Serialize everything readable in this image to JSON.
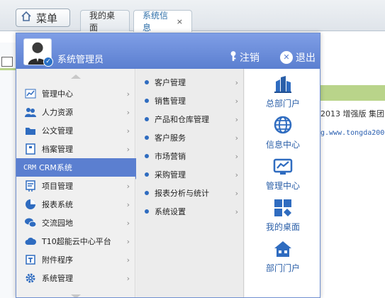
{
  "top": {
    "menu_label": "菜单",
    "tabs": [
      {
        "label": "我的桌面",
        "active": false
      },
      {
        "label": "系统信息",
        "active": true,
        "close": "×"
      }
    ]
  },
  "background": {
    "text1": "2013 增强版 集团",
    "text2": "g.www.tongda2000"
  },
  "popup": {
    "user_name": "系统管理员",
    "logout_label": "注销",
    "exit_label": "退出",
    "primary_menu": [
      {
        "label": "管理中心",
        "icon": "chart-icon"
      },
      {
        "label": "人力资源",
        "icon": "people-icon"
      },
      {
        "label": "公文管理",
        "icon": "folder-icon"
      },
      {
        "label": "档案管理",
        "icon": "archive-icon"
      },
      {
        "label": "CRM系统",
        "tag": "CRM",
        "icon": "crm-icon",
        "active": true
      },
      {
        "label": "项目管理",
        "icon": "project-icon"
      },
      {
        "label": "报表系统",
        "icon": "pie-icon"
      },
      {
        "label": "交流园地",
        "icon": "chat-icon"
      },
      {
        "label": "T10超能云中心平台",
        "icon": "cloud-icon"
      },
      {
        "label": "附件程序",
        "icon": "attachment-icon"
      },
      {
        "label": "系统管理",
        "icon": "gear-icon"
      }
    ],
    "submenu": [
      {
        "label": "客户管理"
      },
      {
        "label": "销售管理"
      },
      {
        "label": "产品和仓库管理"
      },
      {
        "label": "客户服务"
      },
      {
        "label": "市场营销"
      },
      {
        "label": "采购管理"
      },
      {
        "label": "报表分析与统计"
      },
      {
        "label": "系统设置"
      }
    ],
    "shortcuts": [
      {
        "label": "总部门户",
        "icon": "building-icon"
      },
      {
        "label": "信息中心",
        "icon": "globe-icon"
      },
      {
        "label": "管理中心",
        "icon": "monitor-chart-icon"
      },
      {
        "label": "我的桌面",
        "icon": "desktop-grid-icon"
      },
      {
        "label": "部门门户",
        "icon": "house-icon"
      }
    ]
  },
  "colors": {
    "accent": "#5b7fd0",
    "link": "#2b5fa8",
    "highlight_green": "#b9d48a"
  }
}
